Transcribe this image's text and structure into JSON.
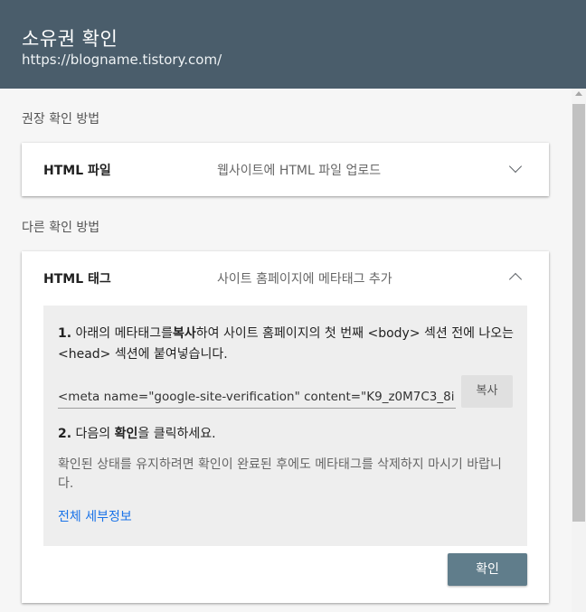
{
  "header": {
    "title": "소유권 확인",
    "url": "https://blogname.tistory.com/"
  },
  "recommended": {
    "section_label": "권장 확인 방법",
    "card": {
      "title": "HTML 파일",
      "description": "웹사이트에 HTML 파일 업로드",
      "expanded": false
    }
  },
  "other": {
    "section_label": "다른 확인 방법",
    "card": {
      "title": "HTML 태그",
      "description": "사이트 홈페이지에 메타태그 추가",
      "expanded": true,
      "step1": {
        "number": "1.",
        "text_a": "아래의 메타태그를",
        "bold": "복사",
        "text_b": "하여 사이트 홈페이지의 첫 번째 <body> 섹션 전에 나오는 <head> 섹션에 붙여넣습니다."
      },
      "meta_tag_value": "<meta name=\"google-site-verification\" content=\"K9_z0M7C3_8i",
      "copy_label": "복사",
      "step2": {
        "number": "2.",
        "text_a": "다음의",
        "bold": "확인",
        "text_b": "을 클릭하세요."
      },
      "note": "확인된 상태를 유지하려면 확인이 완료된 후에도 메타태그를 삭제하지 마시기 바랍니다.",
      "details_link": "전체 세부정보",
      "confirm_label": "확인"
    }
  },
  "colors": {
    "header_bg": "#4a5d6b",
    "confirm_button": "#607d8b",
    "link": "#1a73e8"
  }
}
